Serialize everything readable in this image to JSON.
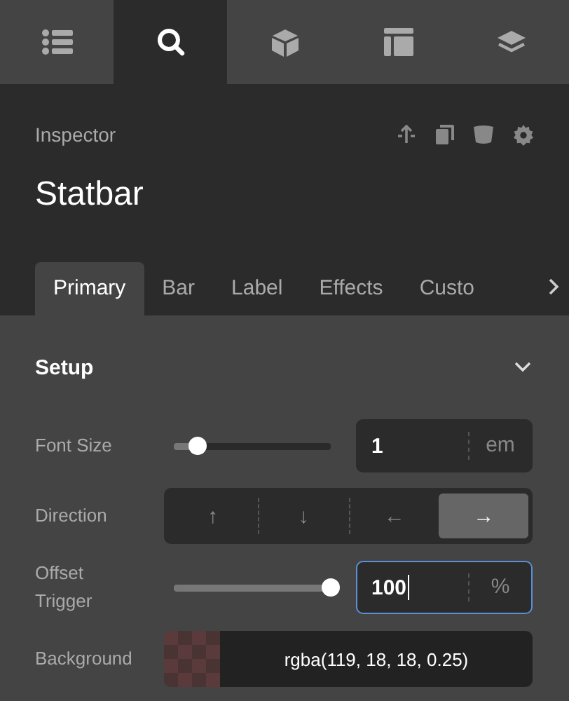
{
  "toolbar": {
    "tabs": [
      {
        "kind": "list",
        "selected": false
      },
      {
        "kind": "search",
        "selected": true
      },
      {
        "kind": "cube",
        "selected": false
      },
      {
        "kind": "layout",
        "selected": false
      },
      {
        "kind": "layers",
        "selected": false
      }
    ]
  },
  "header": {
    "label": "Inspector",
    "title": "Statbar",
    "actions": [
      {
        "kind": "move"
      },
      {
        "kind": "copy"
      },
      {
        "kind": "delete"
      },
      {
        "kind": "settings"
      }
    ]
  },
  "tabs": [
    {
      "label": "Primary",
      "selected": true
    },
    {
      "label": "Bar",
      "selected": false
    },
    {
      "label": "Label",
      "selected": false
    },
    {
      "label": "Effects",
      "selected": false
    },
    {
      "label": "Custo",
      "selected": false
    }
  ],
  "section": {
    "title": "Setup",
    "expanded": true
  },
  "rows": [
    {
      "kind": "slider",
      "label": "Font Size",
      "level": 0.15,
      "value": "1",
      "unit": "em",
      "focused": false
    },
    {
      "kind": "segmented",
      "label": "Direction",
      "options": [
        {
          "label": "↑",
          "selected": false
        },
        {
          "label": "↓",
          "selected": false
        },
        {
          "label": "←",
          "selected": false
        },
        {
          "label": "→",
          "selected": true
        }
      ]
    },
    {
      "kind": "slider",
      "label": "Offset Trigger",
      "level": 1,
      "value": "100",
      "unit": "%",
      "focused": true
    },
    {
      "kind": "color",
      "label": "Background",
      "value": "rgba(119, 18, 18, 0.25)"
    }
  ]
}
